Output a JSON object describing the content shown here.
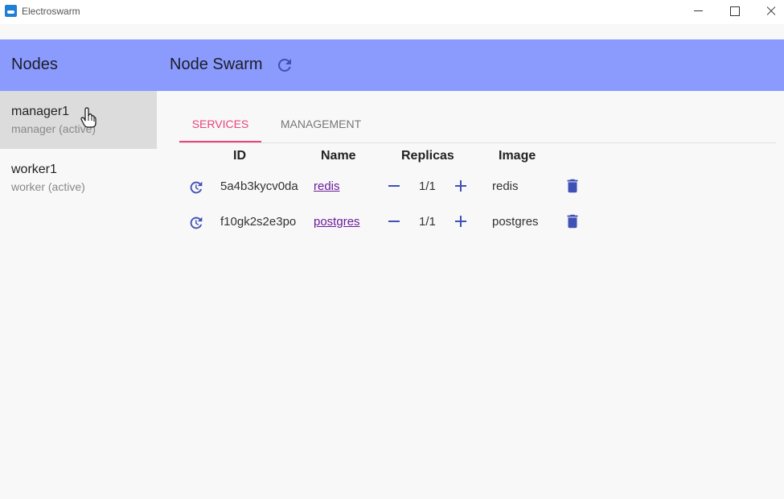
{
  "window": {
    "title": "Electroswarm"
  },
  "sidebar": {
    "header": "Nodes",
    "nodes": [
      {
        "name": "manager1",
        "status": "manager (active)",
        "selected": true
      },
      {
        "name": "worker1",
        "status": "worker (active)",
        "selected": false
      }
    ]
  },
  "main": {
    "title": "Node Swarm",
    "tabs": [
      {
        "label": "SERVICES",
        "active": true
      },
      {
        "label": "MANAGEMENT",
        "active": false
      }
    ],
    "columns": [
      "ID",
      "Name",
      "Replicas",
      "Image"
    ],
    "services": [
      {
        "id": "5a4b3kycv0da",
        "name": "redis",
        "replicas": "1/1",
        "image": "redis"
      },
      {
        "id": "f10gk2s2e3po",
        "name": "postgres",
        "replicas": "1/1",
        "image": "postgres"
      }
    ]
  },
  "colors": {
    "appbar": "#8a9bfd",
    "accent_tab": "#e8457a",
    "icon": "#3f51b5",
    "link": "#6a1b9a"
  },
  "icons": [
    "refresh-icon",
    "restart-icon",
    "minus-icon",
    "plus-icon",
    "delete-icon"
  ]
}
